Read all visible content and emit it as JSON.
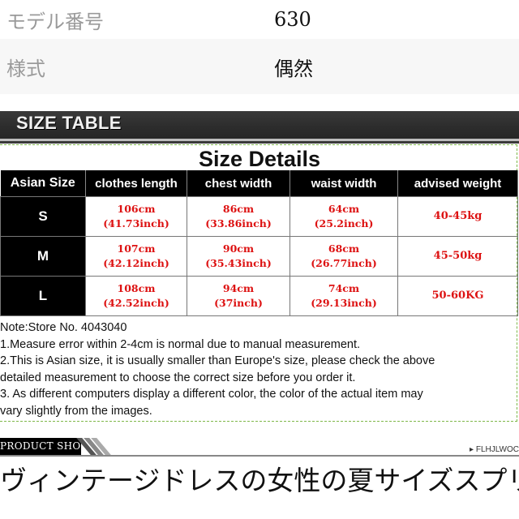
{
  "specs": [
    {
      "label": "モデル番号",
      "value": "630"
    },
    {
      "label": "様式",
      "value": "偶然"
    }
  ],
  "banner": {
    "title": "SIZE TABLE"
  },
  "size_table": {
    "title": "Size Details",
    "headers": [
      "Asian Size",
      "clothes length",
      "chest width",
      "waist width",
      "advised weight"
    ],
    "rows": [
      {
        "size": "S",
        "length_cm": "106cm",
        "length_in": "(41.73inch)",
        "chest_cm": "86cm",
        "chest_in": "(33.86inch)",
        "waist_cm": "64cm",
        "waist_in": "(25.2inch)",
        "weight": "40-45kg"
      },
      {
        "size": "M",
        "length_cm": "107cm",
        "length_in": "(42.12inch)",
        "chest_cm": "90cm",
        "chest_in": "(35.43inch)",
        "waist_cm": "68cm",
        "waist_in": "(26.77inch)",
        "weight": "45-50kg"
      },
      {
        "size": "L",
        "length_cm": "108cm",
        "length_in": "(42.52inch)",
        "chest_cm": "94cm",
        "chest_in": "(37inch)",
        "waist_cm": "74cm",
        "waist_in": "(29.13inch)",
        "weight": "50-60KG"
      }
    ],
    "notes": [
      "Note:Store No. 4043040",
      "1.Measure error within 2-4cm is normal due to manual measurement.",
      "2.This is Asian size, it is usually smaller than Europe's size, please check the above",
      "detailed measurement to choose the correct size before you order it.",
      "3. As different computers display a different color, the color of the actual item may",
      "vary slightly from the images."
    ],
    "colors": {
      "value_text": "#dd1111",
      "header_bg": "#000000",
      "border_dashed": "#7fb84a"
    }
  },
  "product_show": {
    "label": "PRODUCT  SHOW",
    "brand": "▸ FLHJLWOC"
  },
  "description": {
    "line1": "ヴィンテージドレスの女性の夏サイズスプリッ",
    "line2": ""
  }
}
